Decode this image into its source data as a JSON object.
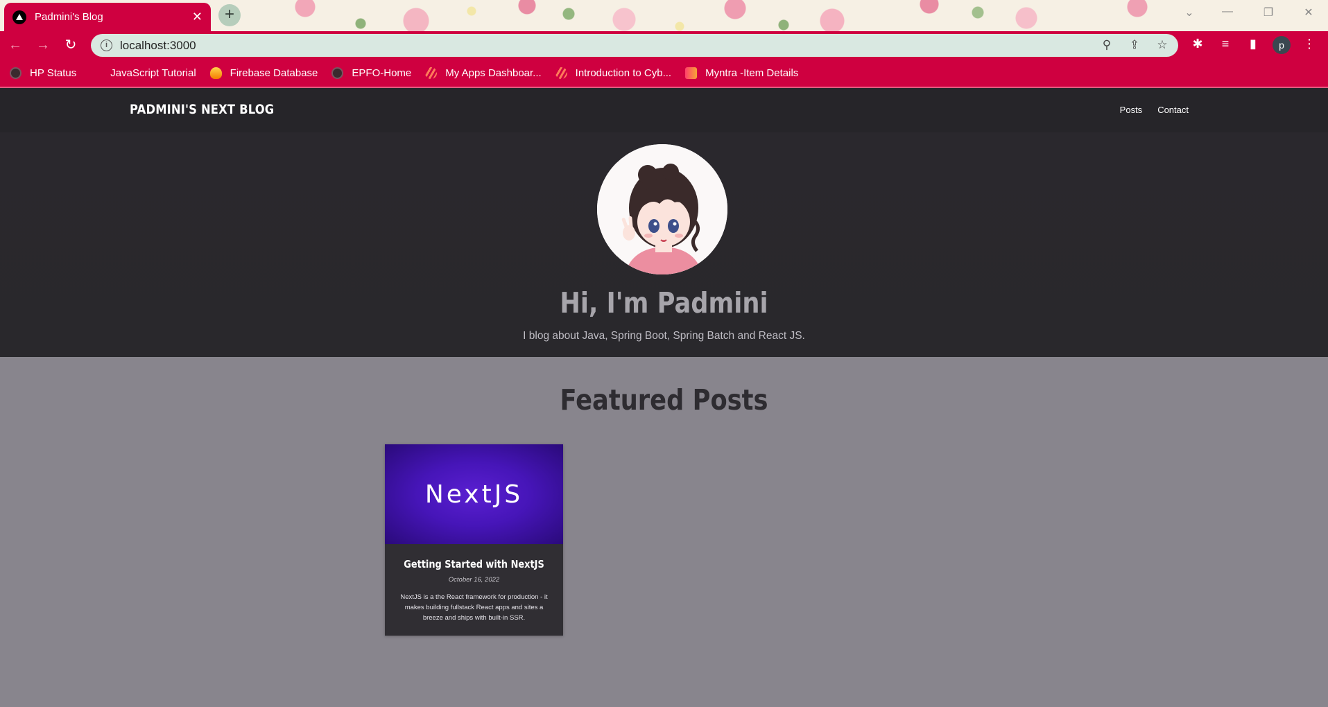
{
  "browser": {
    "tab_title": "Padmini's Blog",
    "url": "localhost:3000",
    "profile_initial": "p",
    "bookmarks": [
      {
        "label": "HP Status",
        "icon": "globe-icon"
      },
      {
        "label": "JavaScript Tutorial",
        "icon": "w3schools-icon"
      },
      {
        "label": "Firebase Database",
        "icon": "firebase-icon"
      },
      {
        "label": "EPFO-Home",
        "icon": "globe-icon"
      },
      {
        "label": "My Apps Dashboar...",
        "icon": "zapier-icon"
      },
      {
        "label": "Introduction to Cyb...",
        "icon": "zapier-icon"
      },
      {
        "label": "Myntra -Item Details",
        "icon": "myntra-icon"
      }
    ],
    "accent_color": "#cf0040"
  },
  "site": {
    "logo": "PADMINI'S NEXT BLOG",
    "nav": {
      "posts": "Posts",
      "contact": "Contact"
    }
  },
  "hero": {
    "title": "Hi, I'm Padmini",
    "subtitle": "I blog about Java, Spring Boot, Spring Batch and React JS."
  },
  "featured": {
    "title": "Featured Posts",
    "posts": [
      {
        "image_text": "NextJS",
        "title": "Getting Started with NextJS",
        "date": "October 16, 2022",
        "excerpt": "NextJS is a the React framework for production - it makes building fullstack React apps and sites a breeze and ships with built-in SSR."
      }
    ]
  }
}
